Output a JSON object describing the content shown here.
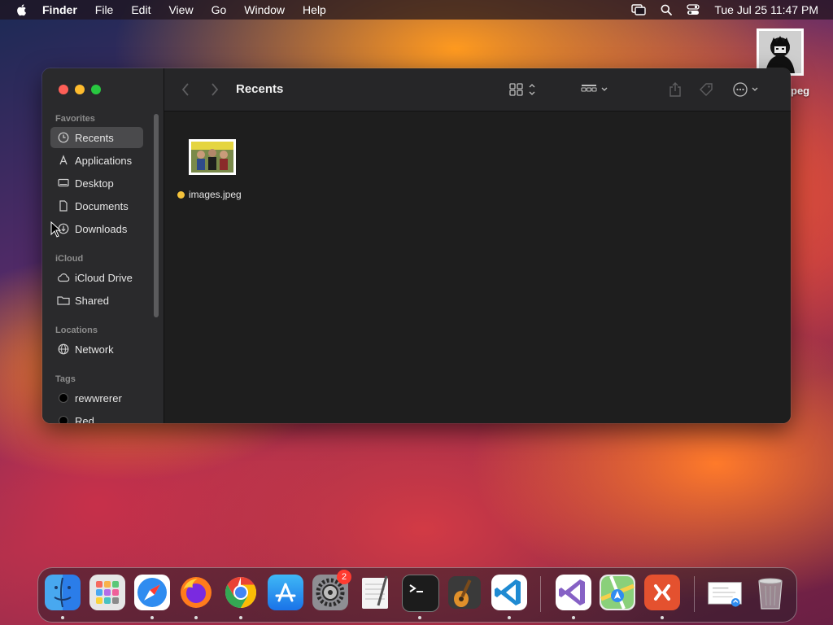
{
  "menubar": {
    "app_name": "Finder",
    "menus": [
      "File",
      "Edit",
      "View",
      "Go",
      "Window",
      "Help"
    ],
    "clock": "Tue Jul 25  11:47 PM",
    "icons": [
      "apple-icon",
      "screen-mirroring-icon",
      "spotlight-icon",
      "control-center-icon"
    ]
  },
  "desktop": {
    "file_label": "peg"
  },
  "finder": {
    "title": "Recents",
    "sidebar": {
      "favorites_header": "Favorites",
      "favorites": [
        {
          "label": "Recents",
          "icon": "clock-icon",
          "selected": true
        },
        {
          "label": "Applications",
          "icon": "applications-icon"
        },
        {
          "label": "Desktop",
          "icon": "desktop-icon"
        },
        {
          "label": "Documents",
          "icon": "document-icon"
        },
        {
          "label": "Downloads",
          "icon": "downloads-icon"
        }
      ],
      "icloud_header": "iCloud",
      "icloud": [
        {
          "label": "iCloud Drive",
          "icon": "cloud-icon"
        },
        {
          "label": "Shared",
          "icon": "shared-folder-icon"
        }
      ],
      "locations_header": "Locations",
      "locations": [
        {
          "label": "Network",
          "icon": "globe-icon"
        }
      ],
      "tags_header": "Tags",
      "tags": [
        {
          "label": "rewwrerer",
          "color": "#000000"
        },
        {
          "label": "Red",
          "color": "#000000"
        }
      ]
    },
    "files": [
      {
        "name": "images.jpeg",
        "tag_color": "#f5c33b"
      }
    ]
  },
  "dock": {
    "apps": [
      "Finder",
      "Launchpad",
      "Safari",
      "Firefox",
      "Google Chrome",
      "App Store",
      "System Settings",
      "TextEdit",
      "Terminal",
      "GarageBand",
      "Visual Studio Code",
      "Visual Studio",
      "Maps",
      "Remote Desktop",
      "Preview",
      "Trash"
    ],
    "system_settings_badge": "2"
  },
  "colors": {
    "close": "#fe5f57",
    "minimize": "#febc2e",
    "maximize": "#28c840",
    "window_bg": "#1e1e1e",
    "sidebar_bg": "#2a2a2c"
  }
}
